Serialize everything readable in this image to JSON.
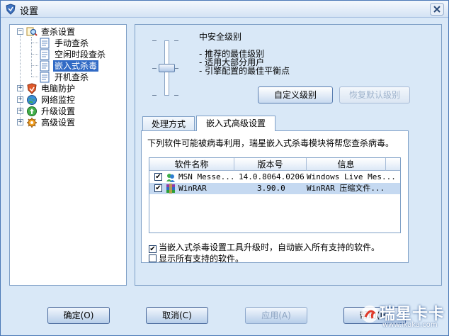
{
  "window": {
    "title": "设置",
    "close_icon": "close-icon"
  },
  "tree": {
    "items": [
      {
        "label": "查杀设置",
        "icon": "magnifier-icon",
        "expander": "−"
      },
      {
        "label": "手动查杀",
        "icon": "document-icon"
      },
      {
        "label": "空闲时段查杀",
        "icon": "document-icon"
      },
      {
        "label": "嵌入式杀毒",
        "icon": "document-icon"
      },
      {
        "label": "开机查杀",
        "icon": "document-icon"
      },
      {
        "label": "电脑防护",
        "icon": "shield-icon",
        "expander": "+"
      },
      {
        "label": "网络监控",
        "icon": "globe-icon",
        "expander": "+"
      },
      {
        "label": "升级设置",
        "icon": "update-icon",
        "expander": "+"
      },
      {
        "label": "高级设置",
        "icon": "gear-icon",
        "expander": "+"
      }
    ]
  },
  "security_level": {
    "title": "中安全级别",
    "lines": [
      "- 推荐的最佳级别",
      "- 适用大部分用户",
      "- 引擎配置的最佳平衡点"
    ],
    "custom_button": "自定义级别",
    "restore_button": "恢复默认级别"
  },
  "tabs": [
    {
      "label": "处理方式"
    },
    {
      "label": "嵌入式高级设置"
    }
  ],
  "embedded": {
    "description": "下列软件可能被病毒利用，瑞星嵌入式杀毒模块将帮您查杀病毒。",
    "columns": [
      "软件名称",
      "版本号",
      "信息"
    ],
    "rows": [
      {
        "checked": "✔",
        "name": "MSN Messe...",
        "version": "14.0.8064.0206",
        "info": "Windows Live Mes..."
      },
      {
        "checked": "✔",
        "name": "WinRAR",
        "version": "3.90.0",
        "info": "WinRAR 压缩文件..."
      }
    ],
    "options": [
      {
        "checked": "✔",
        "label": "当嵌入式杀毒设置工具升级时，自动嵌入所有支持的软件。"
      },
      {
        "checked": "",
        "label": "显示所有支持的软件。"
      }
    ]
  },
  "footer": {
    "ok": "确定(O)",
    "cancel": "取消(C)",
    "apply": "应用(A)",
    "help": "帮助(H)"
  },
  "watermark": {
    "big": "瑞星卡卡",
    "small": "www.ikaka.com"
  }
}
